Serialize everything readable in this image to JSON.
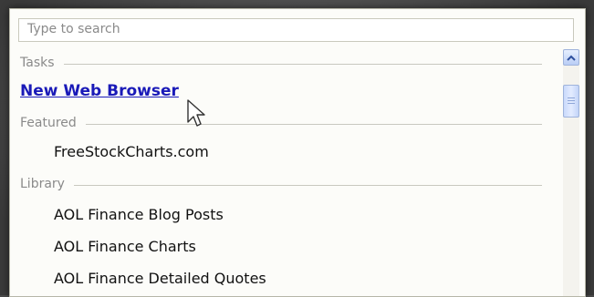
{
  "search": {
    "placeholder": "Type to search"
  },
  "groups": {
    "tasks": {
      "header": "Tasks",
      "items": [
        "New Web Browser"
      ]
    },
    "featured": {
      "header": "Featured",
      "items": [
        "FreeStockCharts.com"
      ]
    },
    "library": {
      "header": "Library",
      "items": [
        "AOL Finance Blog Posts",
        "AOL Finance Charts",
        "AOL Finance Detailed Quotes"
      ]
    }
  },
  "icons": {
    "scroll_up": "chevron-up-icon",
    "scroll_thumb": "grip-icon",
    "cursor": "mouse-pointer-icon"
  },
  "colors": {
    "link": "#1a1ab8",
    "panel_bg": "#fcfcf9",
    "header_text": "#8a8a8a",
    "scroll_accent": "#b9cdf5"
  }
}
